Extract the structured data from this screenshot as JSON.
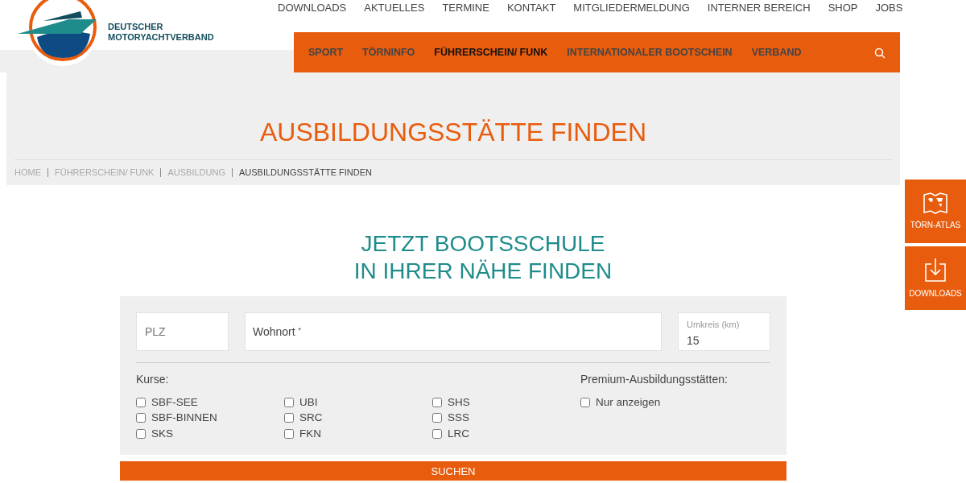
{
  "logo": {
    "line1": "DEUTSCHER",
    "line2": "MOTORYACHTVERBAND"
  },
  "top_links": [
    "DOWNLOADS",
    "AKTUELLES",
    "TERMINE",
    "KONTAKT",
    "MITGLIEDERMELDUNG",
    "INTERNER BEREICH",
    "SHOP",
    "JOBS"
  ],
  "main_nav": [
    {
      "label": "SPORT",
      "selected": false
    },
    {
      "label": "TÖRNINFO",
      "selected": false
    },
    {
      "label": "FÜHRERSCHEIN/ FUNK",
      "selected": true
    },
    {
      "label": "INTERNATIONALER BOOTSCHEIN",
      "selected": false
    },
    {
      "label": "VERBAND",
      "selected": false
    }
  ],
  "page_title": "AUSBILDUNGSSTÄTTE FINDEN",
  "breadcrumb": [
    {
      "label": "HOME",
      "current": false
    },
    {
      "label": "FÜHRERSCHEIN/ FUNK",
      "current": false
    },
    {
      "label": "AUSBILDUNG",
      "current": false
    },
    {
      "label": "AUSBILDUNGSSTÄTTE FINDEN",
      "current": true
    }
  ],
  "side_buttons": [
    {
      "kind": "map",
      "label": "TÖRN-ATLAS"
    },
    {
      "kind": "download",
      "label": "DOWNLOADS"
    }
  ],
  "heading": [
    "JETZT BOOTSSCHULE",
    "IN IHRER NÄHE FINDEN"
  ],
  "form": {
    "plz": {
      "placeholder": "PLZ"
    },
    "wohnort": {
      "label": "Wohnort $^{*}$"
    },
    "umkreis": {
      "label": "Umkreis (km)",
      "value": "15"
    },
    "courses_label": "Kurse:",
    "course_columns": [
      [
        {
          "label": "SBF-SEE",
          "checked": false
        },
        {
          "label": "SBF-BINNEN",
          "checked": false
        },
        {
          "label": "SKS",
          "checked": false
        }
      ],
      [
        {
          "label": "UBI",
          "checked": false
        },
        {
          "label": "SRC",
          "checked": false
        },
        {
          "label": "FKN",
          "checked": false
        }
      ],
      [
        {
          "label": "SHS",
          "checked": false
        },
        {
          "label": "SSS",
          "checked": false
        },
        {
          "label": "LRC",
          "checked": false
        }
      ]
    ],
    "premium_label": "Premium-Ausbildungsstätten:",
    "premium": {
      "label": "Nur anzeigen",
      "checked": false
    },
    "submit": "SUCHEN"
  }
}
